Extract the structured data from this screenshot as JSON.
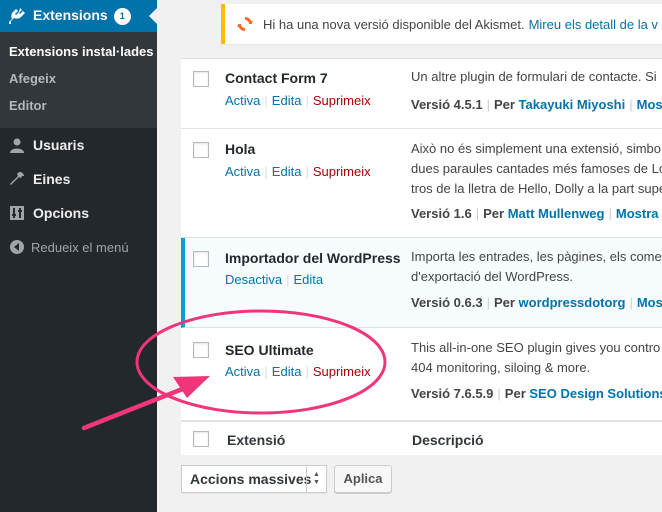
{
  "sidebar": {
    "active_menu": {
      "label": "Extensions",
      "badge": "1",
      "icon": "plugins-icon"
    },
    "submenu": [
      "Extensions instal·lades",
      "Afegeix",
      "Editor"
    ],
    "items": [
      {
        "label": "Usuaris",
        "icon": "users-icon"
      },
      {
        "label": "Eines",
        "icon": "tools-icon"
      },
      {
        "label": "Opcions",
        "icon": "settings-icon"
      },
      {
        "label": "Redueix el menú",
        "icon": "collapse-icon"
      }
    ]
  },
  "notice": {
    "icon": "update-icon",
    "text": "Hi ha una nova versió disponible del Akismet.",
    "link": "Mireu els detall de la v"
  },
  "plugins": [
    {
      "name": "Contact Form 7",
      "actions": [
        "Activa",
        "Edita",
        "Suprimeix"
      ],
      "description": [
        "Un altre plugin de formulari de contacte. Si"
      ],
      "version": "Versió 4.5.1",
      "by": "Per",
      "author": "Takayuki Miyoshi",
      "more": "Mostra"
    },
    {
      "name": "Hola",
      "actions": [
        "Activa",
        "Edita",
        "Suprimeix"
      ],
      "description": [
        "Això no és simplement una extensió, simbo",
        "dues paraules cantades més famoses de Lo",
        "tros de la lletra de Hello, Dolly a la part supe"
      ],
      "version": "Versió 1.6",
      "by": "Per",
      "author": "Matt Mullenweg",
      "more": "Mostra el"
    },
    {
      "name": "Importador del WordPress",
      "actions": [
        "Desactiva",
        "Edita"
      ],
      "description": [
        "Importa les entrades, les pàgines, els come",
        "d'exportació del WordPress."
      ],
      "version": "Versió 0.6.3",
      "by": "Per",
      "author": "wordpressdotorg",
      "more": "Mostra"
    },
    {
      "name": "SEO Ultimate",
      "actions": [
        "Activa",
        "Edita",
        "Suprimeix"
      ],
      "description": [
        "This all-in-one SEO plugin gives you contro",
        "404 monitoring, siloing & more."
      ],
      "version": "Versió 7.6.5.9",
      "by": "Per",
      "author": "SEO Design Solutions",
      "more": ""
    }
  ],
  "footer": {
    "col_plugin": "Extensió",
    "col_desc": "Descripció"
  },
  "bulk": {
    "label": "Accions massives",
    "apply": "Aplica"
  },
  "colors": {
    "sidebar": "#23282d",
    "accent": "#0073aa",
    "delete": "#aa0000",
    "annotation": "#f0357a"
  }
}
